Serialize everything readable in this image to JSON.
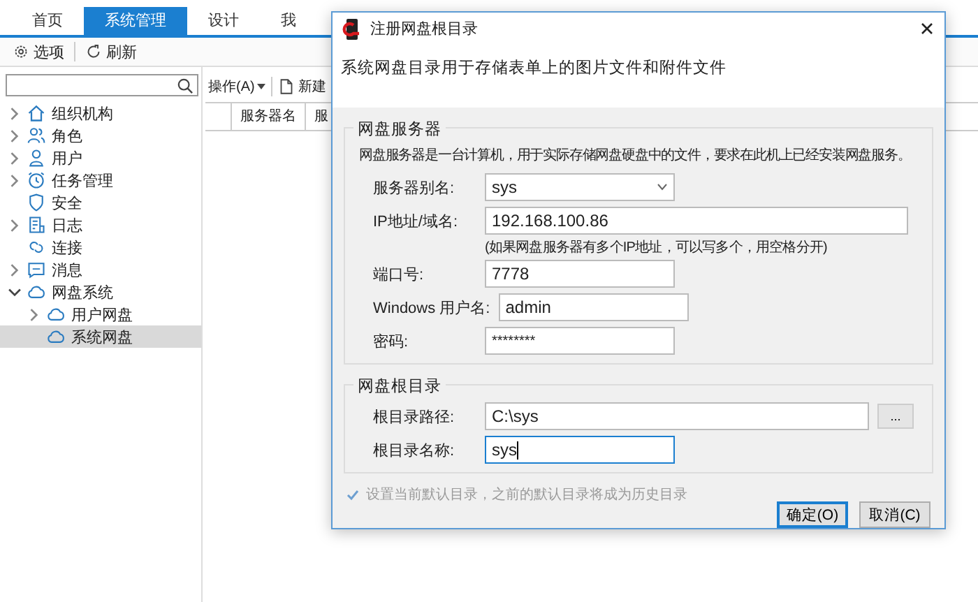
{
  "tabs": [
    {
      "label": "首页",
      "selected": false
    },
    {
      "label": "系统管理",
      "selected": true
    },
    {
      "label": "设计",
      "selected": false
    },
    {
      "label": "我",
      "selected": false
    }
  ],
  "toolbar": [
    {
      "label": "选项",
      "kind": "gear"
    },
    {
      "label": "刷新",
      "kind": "refresh"
    }
  ],
  "sidebar": {
    "items": [
      {
        "label": "组织机构",
        "kind": "home",
        "expanded": false,
        "selected": false
      },
      {
        "label": "角色",
        "kind": "people",
        "expanded": false,
        "selected": false
      },
      {
        "label": "用户",
        "kind": "person",
        "expanded": false,
        "selected": false
      },
      {
        "label": "任务管理",
        "kind": "clock",
        "expanded": false,
        "selected": false
      },
      {
        "label": "安全",
        "kind": "shield",
        "selected": false
      },
      {
        "label": "日志",
        "kind": "log",
        "expanded": false,
        "selected": false
      },
      {
        "label": "连接",
        "kind": "link",
        "selected": false
      },
      {
        "label": "消息",
        "kind": "message",
        "expanded": false,
        "selected": false
      },
      {
        "label": "网盘系统",
        "kind": "cloud",
        "expanded": true,
        "selected": false,
        "children": [
          {
            "label": "用户网盘",
            "kind": "cloud",
            "expanded": false,
            "selected": false
          },
          {
            "label": "系统网盘",
            "kind": "cloud",
            "selected": true
          }
        ]
      }
    ]
  },
  "content": {
    "toolbar": [
      {
        "label": "操作(A)",
        "kind": "menu"
      },
      {
        "label": "新建",
        "kind": "new"
      }
    ],
    "table": {
      "columns": [
        "服务器名",
        "服"
      ]
    }
  },
  "dialog": {
    "title": "注册网盘根目录",
    "description": "系统网盘目录用于存储表单上的图片文件和附件文件",
    "groups": [
      {
        "title": "网盘服务器",
        "rows": [
          {
            "kind": "note",
            "text": "网盘服务器是一台计算机，用于实际存储网盘硬盘中的文件，要求在此机上已经安装网盘服务。"
          },
          {
            "kind": "select",
            "label": "服务器别名:",
            "value": "sys",
            "focused": false
          },
          {
            "kind": "wide-text",
            "label": "IP地址/域名:",
            "value": "192.168.100.86",
            "focused": false
          },
          {
            "kind": "hint",
            "text": "(如果网盘服务器有多个IP地址，可以写多个，用空格分开)"
          },
          {
            "kind": "text",
            "label": "端口号:",
            "value": "7778",
            "focused": false
          },
          {
            "kind": "text",
            "label": "Windows 用户名:",
            "value": "admin",
            "focused": false
          },
          {
            "kind": "password",
            "label": "密码:",
            "value": "********",
            "focused": false
          }
        ]
      },
      {
        "title": "网盘根目录",
        "rows": [
          {
            "kind": "browse",
            "label": "根目录路径:",
            "value": "C:\\sys",
            "button": "...",
            "focused": false
          },
          {
            "kind": "text",
            "label": "根目录名称:",
            "value": "sys",
            "focused": true
          }
        ]
      }
    ],
    "checkbox": {
      "label": "设置当前默认目录，之前的默认目录将成为历史目录",
      "checked": true,
      "disabled": true
    },
    "buttons": [
      {
        "label": "确定(O)",
        "default": true
      },
      {
        "label": "取消(C)",
        "default": false
      }
    ]
  }
}
